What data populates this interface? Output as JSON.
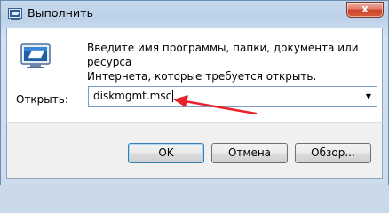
{
  "window": {
    "title": "Выполнить",
    "close_symbol": "x",
    "title_icon": "run-window-icon"
  },
  "content": {
    "description_line1": "Введите имя программы, папки, документа или ресурса",
    "description_line2": "Интернета, которые требуется открыть.",
    "open_label": "Открыть:",
    "open_value": "diskmgmt.msc",
    "dropdown_symbol": "▼",
    "run_icon": "run-dialog-icon"
  },
  "buttons": {
    "ok": "OK",
    "cancel": "Отмена",
    "browse": "Обзор..."
  },
  "annotation": {
    "arrow_color": "#e8232a"
  },
  "colors": {
    "accent_blue": "#3c7fb1",
    "close_red": "#c8452c"
  }
}
